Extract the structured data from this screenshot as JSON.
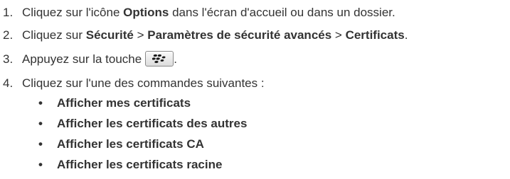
{
  "steps": [
    {
      "number": "1.",
      "text_before": "Cliquez sur l'icône ",
      "bold": "Options",
      "text_after": " dans l'écran d'accueil ou dans un dossier."
    },
    {
      "number": "2.",
      "text_before": "Cliquez sur ",
      "bold_1": "Sécurité",
      "sep_1": " > ",
      "bold_2": "Paramètres de sécurité avancés",
      "sep_2": " > ",
      "bold_3": "Certificats",
      "text_after": "."
    },
    {
      "number": "3.",
      "text_before": "Appuyez sur la touche",
      "key_icon": "blackberry-menu-key-icon",
      "text_after": "."
    },
    {
      "number": "4.",
      "text": "Cliquez sur l'une des commandes suivantes :"
    }
  ],
  "bullet_symbol": "•",
  "commands": [
    "Afficher mes certificats",
    "Afficher les certificats des autres",
    "Afficher les certificats CA",
    "Afficher les certificats racine"
  ]
}
